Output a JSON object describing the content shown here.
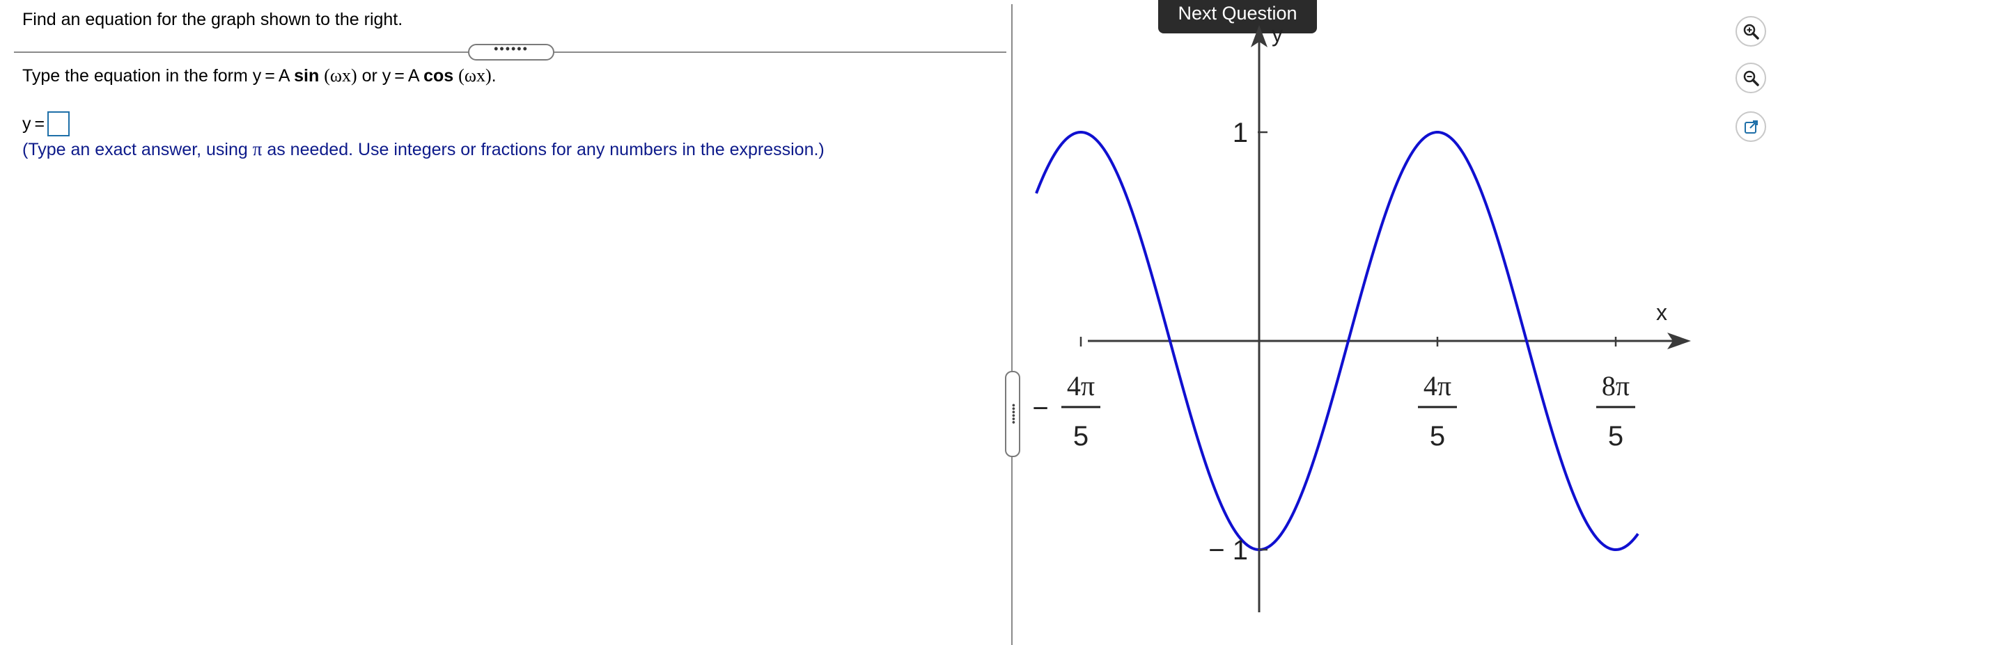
{
  "question": {
    "prompt": "Find an equation for the graph shown to the right.",
    "instr_pre": "Type the equation in the form y = A ",
    "sin": "sin",
    "omega_x_1": "(ωx)",
    "or_text": " or y = A ",
    "cos": "cos",
    "omega_x_2": "(ωx)",
    "period": ".",
    "answer_label": "y =",
    "answer_value": "",
    "hint_pre": "(Type an exact answer, using ",
    "pi": "π",
    "hint_post": " as needed. Use integers or fractions for any numbers in the expression.)",
    "divider_dots": "••••••",
    "vertical_dots": "••••••"
  },
  "next_button": "Next Question",
  "toolbar": [
    "zoom-in-icon",
    "zoom-out-icon",
    "popout-icon"
  ],
  "chart_data": {
    "type": "line",
    "function": "y = -cos(5x/4)",
    "x_range_pi": [
      -1.0,
      1.7
    ],
    "ylim": [
      -1,
      1
    ],
    "xlabel": "x",
    "ylabel": "y",
    "x_ticks": [
      {
        "sign": "−",
        "num": "4π",
        "den": "5"
      },
      {
        "sign": "",
        "num": "4π",
        "den": "5"
      },
      {
        "sign": "",
        "num": "8π",
        "den": "5"
      }
    ],
    "y_ticks": [
      {
        "label": "1"
      },
      {
        "label": "− 1"
      }
    ],
    "curve_color": "#1010d0",
    "axis_color": "#3a3a3a"
  }
}
